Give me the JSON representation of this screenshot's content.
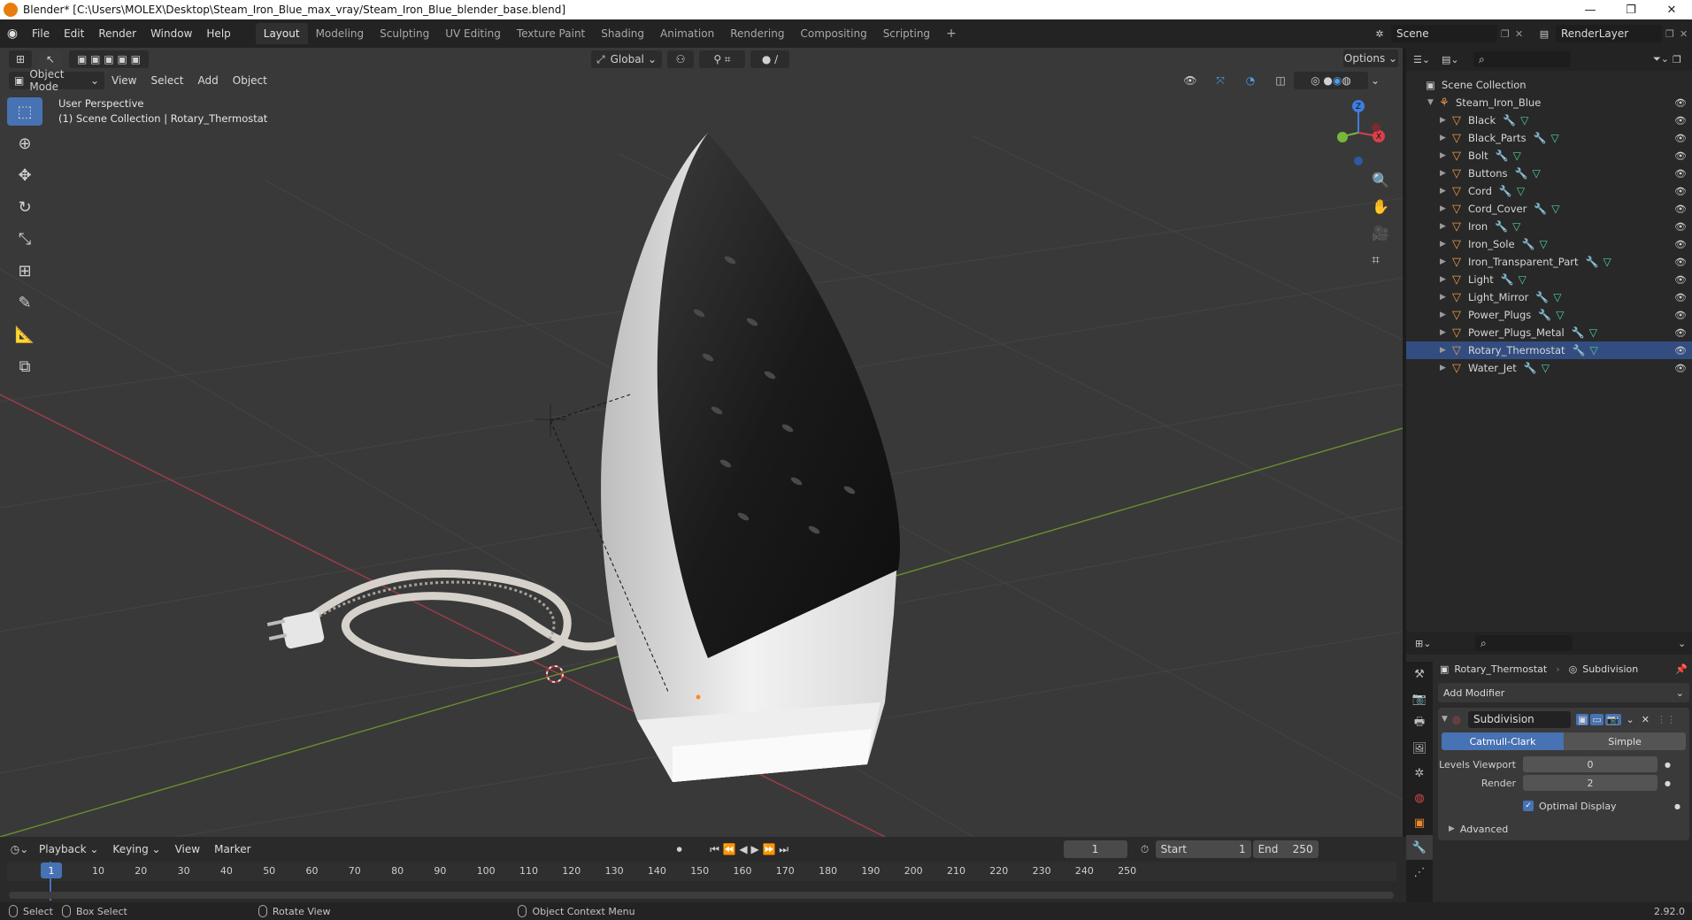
{
  "title_bar": {
    "title": "Blender* [C:\\Users\\MOLEX\\Desktop\\Steam_Iron_Blue_max_vray/Steam_Iron_Blue_blender_base.blend]",
    "minimize": "—",
    "maximize": "❐",
    "close": "✕"
  },
  "menu": {
    "items": [
      "File",
      "Edit",
      "Render",
      "Window",
      "Help"
    ]
  },
  "workspaces": [
    "Layout",
    "Modeling",
    "Sculpting",
    "UV Editing",
    "Texture Paint",
    "Shading",
    "Animation",
    "Rendering",
    "Compositing",
    "Scripting"
  ],
  "scene": {
    "scene_name": "Scene",
    "render_layer": "RenderLayer"
  },
  "viewport_header": {
    "mode": "Object Mode",
    "view": "View",
    "select": "Select",
    "add": "Add",
    "object": "Object",
    "transform_orientation": "Global",
    "options": "Options"
  },
  "viewport": {
    "perspective": "User Perspective",
    "collection_info": "(1) Scene Collection | Rotary_Thermostat"
  },
  "outliner": {
    "root": "Scene Collection",
    "collection": "Steam_Iron_Blue",
    "objects": [
      "Black",
      "Black_Parts",
      "Bolt",
      "Buttons",
      "Cord",
      "Cord_Cover",
      "Iron",
      "Iron_Sole",
      "Iron_Transparent_Part",
      "Light",
      "Light_Mirror",
      "Power_Plugs",
      "Power_Plugs_Metal",
      "Rotary_Thermostat",
      "Water_Jet"
    ],
    "selected": "Rotary_Thermostat"
  },
  "properties": {
    "object_name": "Rotary_Thermostat",
    "modifier_tab": "Subdivision",
    "add_modifier": "Add Modifier",
    "modifier_name": "Subdivision",
    "type_catmull": "Catmull-Clark",
    "type_simple": "Simple",
    "levels_viewport_label": "Levels Viewport",
    "levels_viewport_value": "0",
    "render_label": "Render",
    "render_value": "2",
    "optimal_display": "Optimal Display",
    "advanced": "Advanced"
  },
  "timeline": {
    "playback": "Playback",
    "keying": "Keying",
    "view": "View",
    "marker": "Marker",
    "current_frame": "1",
    "start_label": "Start",
    "start_value": "1",
    "end_label": "End",
    "end_value": "250",
    "ruler": [
      "1",
      "10",
      "20",
      "30",
      "40",
      "50",
      "60",
      "70",
      "80",
      "90",
      "100",
      "110",
      "120",
      "130",
      "140",
      "150",
      "160",
      "170",
      "180",
      "190",
      "200",
      "210",
      "220",
      "230",
      "240",
      "250"
    ]
  },
  "status": {
    "select": "Select",
    "box_select": "Box Select",
    "rotate_view": "Rotate View",
    "context_menu": "Object Context Menu",
    "version": "2.92.0"
  }
}
